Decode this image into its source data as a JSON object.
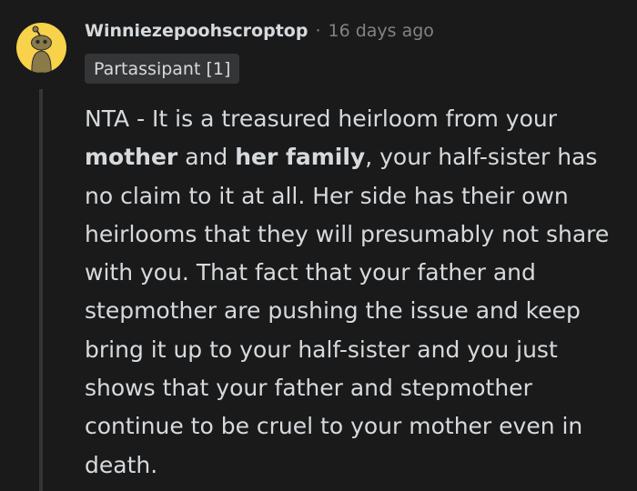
{
  "comment": {
    "author": "Winniezepoohscroptop",
    "separator": "·",
    "timestamp": "16 days ago",
    "flair": "Partassipant [1]",
    "avatar_icon": "snoo-avatar-icon",
    "body": {
      "part1": "NTA - It is a treasured heirloom from your ",
      "bold1": "mother",
      "part2": " and ",
      "bold2": "her family",
      "part3": ", your half-sister has no claim to it at all. Her side has their own heirlooms that they will presumably not share with you. That fact that your father and stepmother are pushing the issue and keep bring it up to your half-sister and you just shows that your father and stepmother continue to be cruel to your mother even in death."
    }
  },
  "colors": {
    "background": "#1a1a1b",
    "avatar_bg": "#f7d24a",
    "text": "#d7dadc",
    "muted": "#818384",
    "flair_bg": "#343536"
  }
}
